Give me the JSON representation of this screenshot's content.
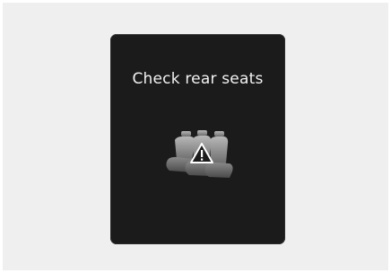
{
  "display": {
    "message": "Check rear seats",
    "icon": "rear-seats-warning-icon"
  }
}
